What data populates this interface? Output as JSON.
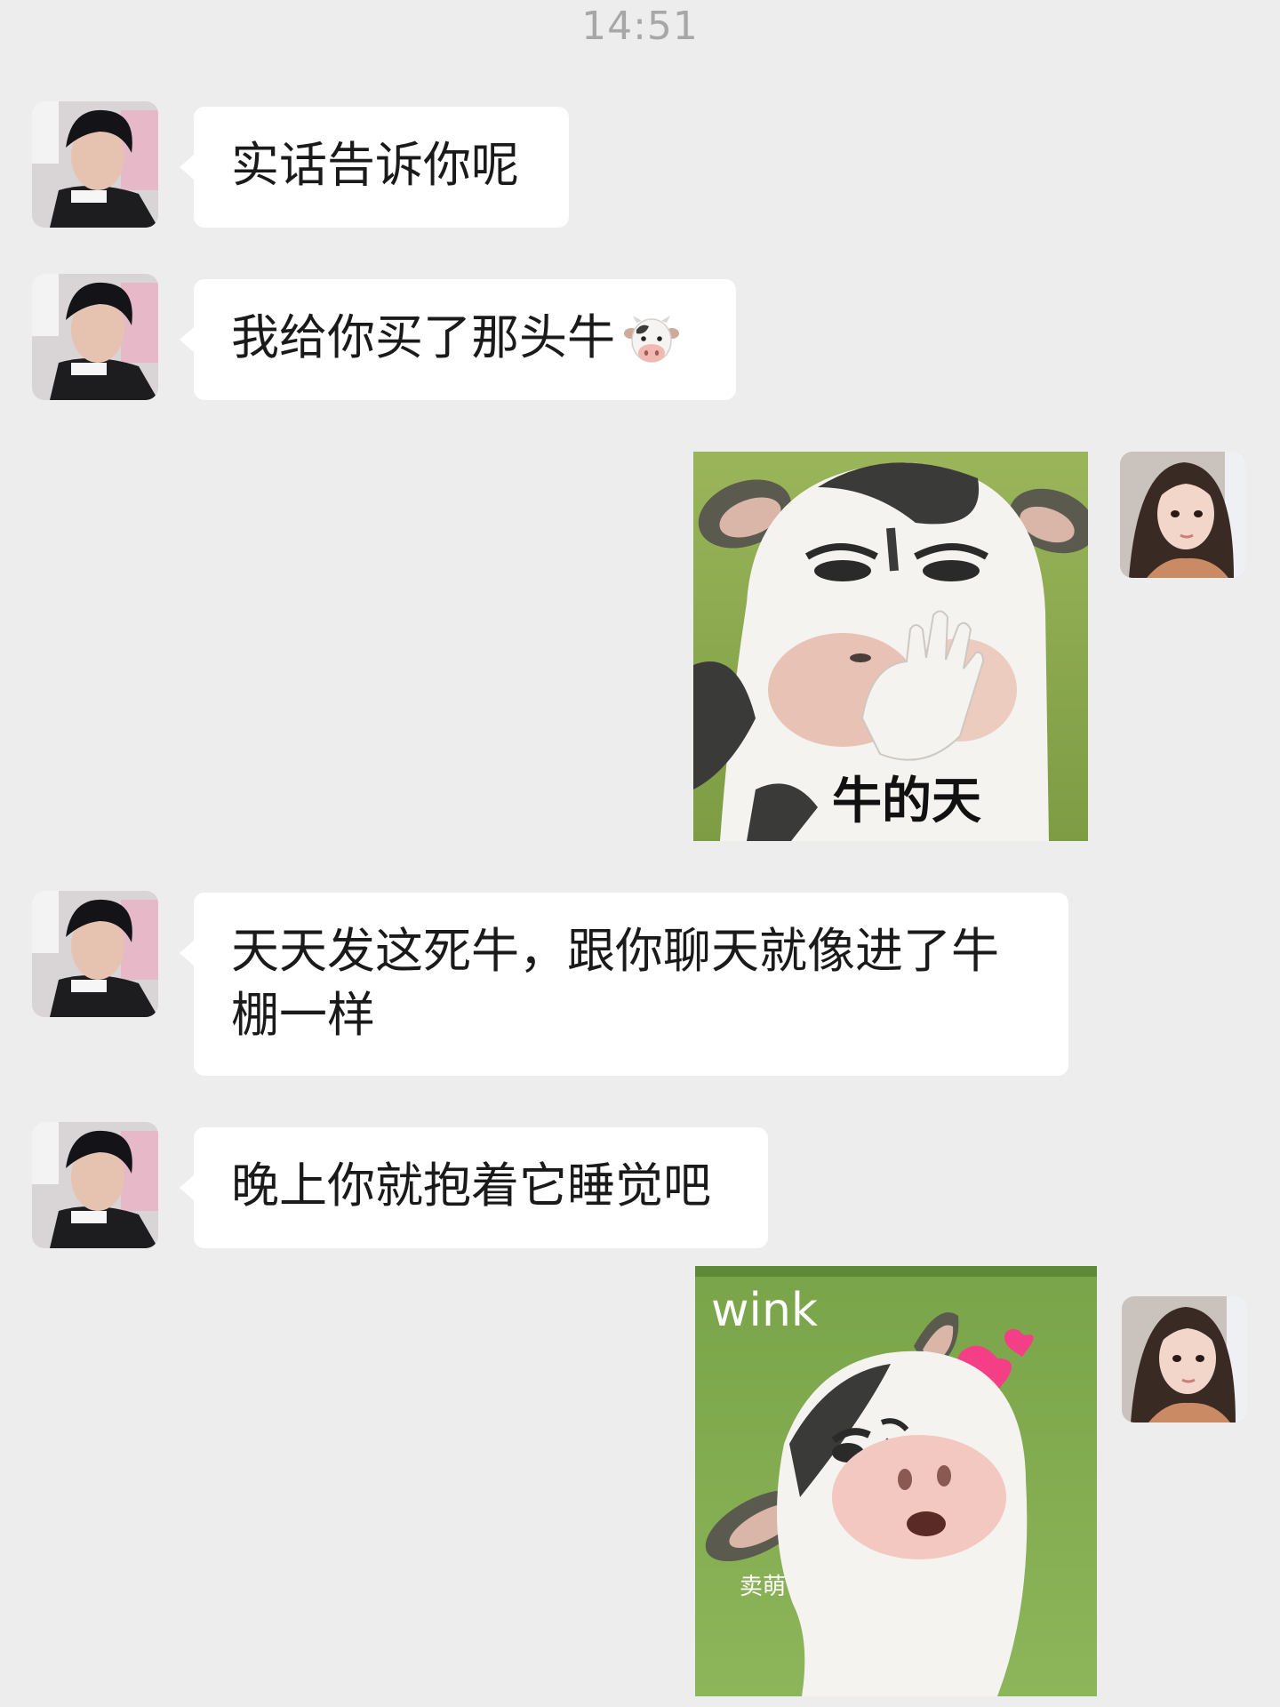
{
  "status_time": "14:51",
  "messages": [
    {
      "sender": "them",
      "type": "text",
      "text": "实话告诉你呢"
    },
    {
      "sender": "them",
      "type": "text",
      "text": "我给你买了那头牛",
      "emoji": "cow-face-icon"
    },
    {
      "sender": "me",
      "type": "sticker",
      "caption": "牛的天"
    },
    {
      "sender": "them",
      "type": "text",
      "text": "天天发这死牛，跟你聊天就像进了牛棚一样"
    },
    {
      "sender": "them",
      "type": "text",
      "text": "晚上你就抱着它睡觉吧"
    },
    {
      "sender": "me",
      "type": "sticker",
      "caption": "wink",
      "sub_caption": "卖萌"
    }
  ],
  "colors": {
    "background": "#ededed",
    "bubble": "#ffffff",
    "text": "#1a1a1a",
    "timestamp": "#a7a7a7",
    "sticker_grass": "#8aa84a"
  }
}
